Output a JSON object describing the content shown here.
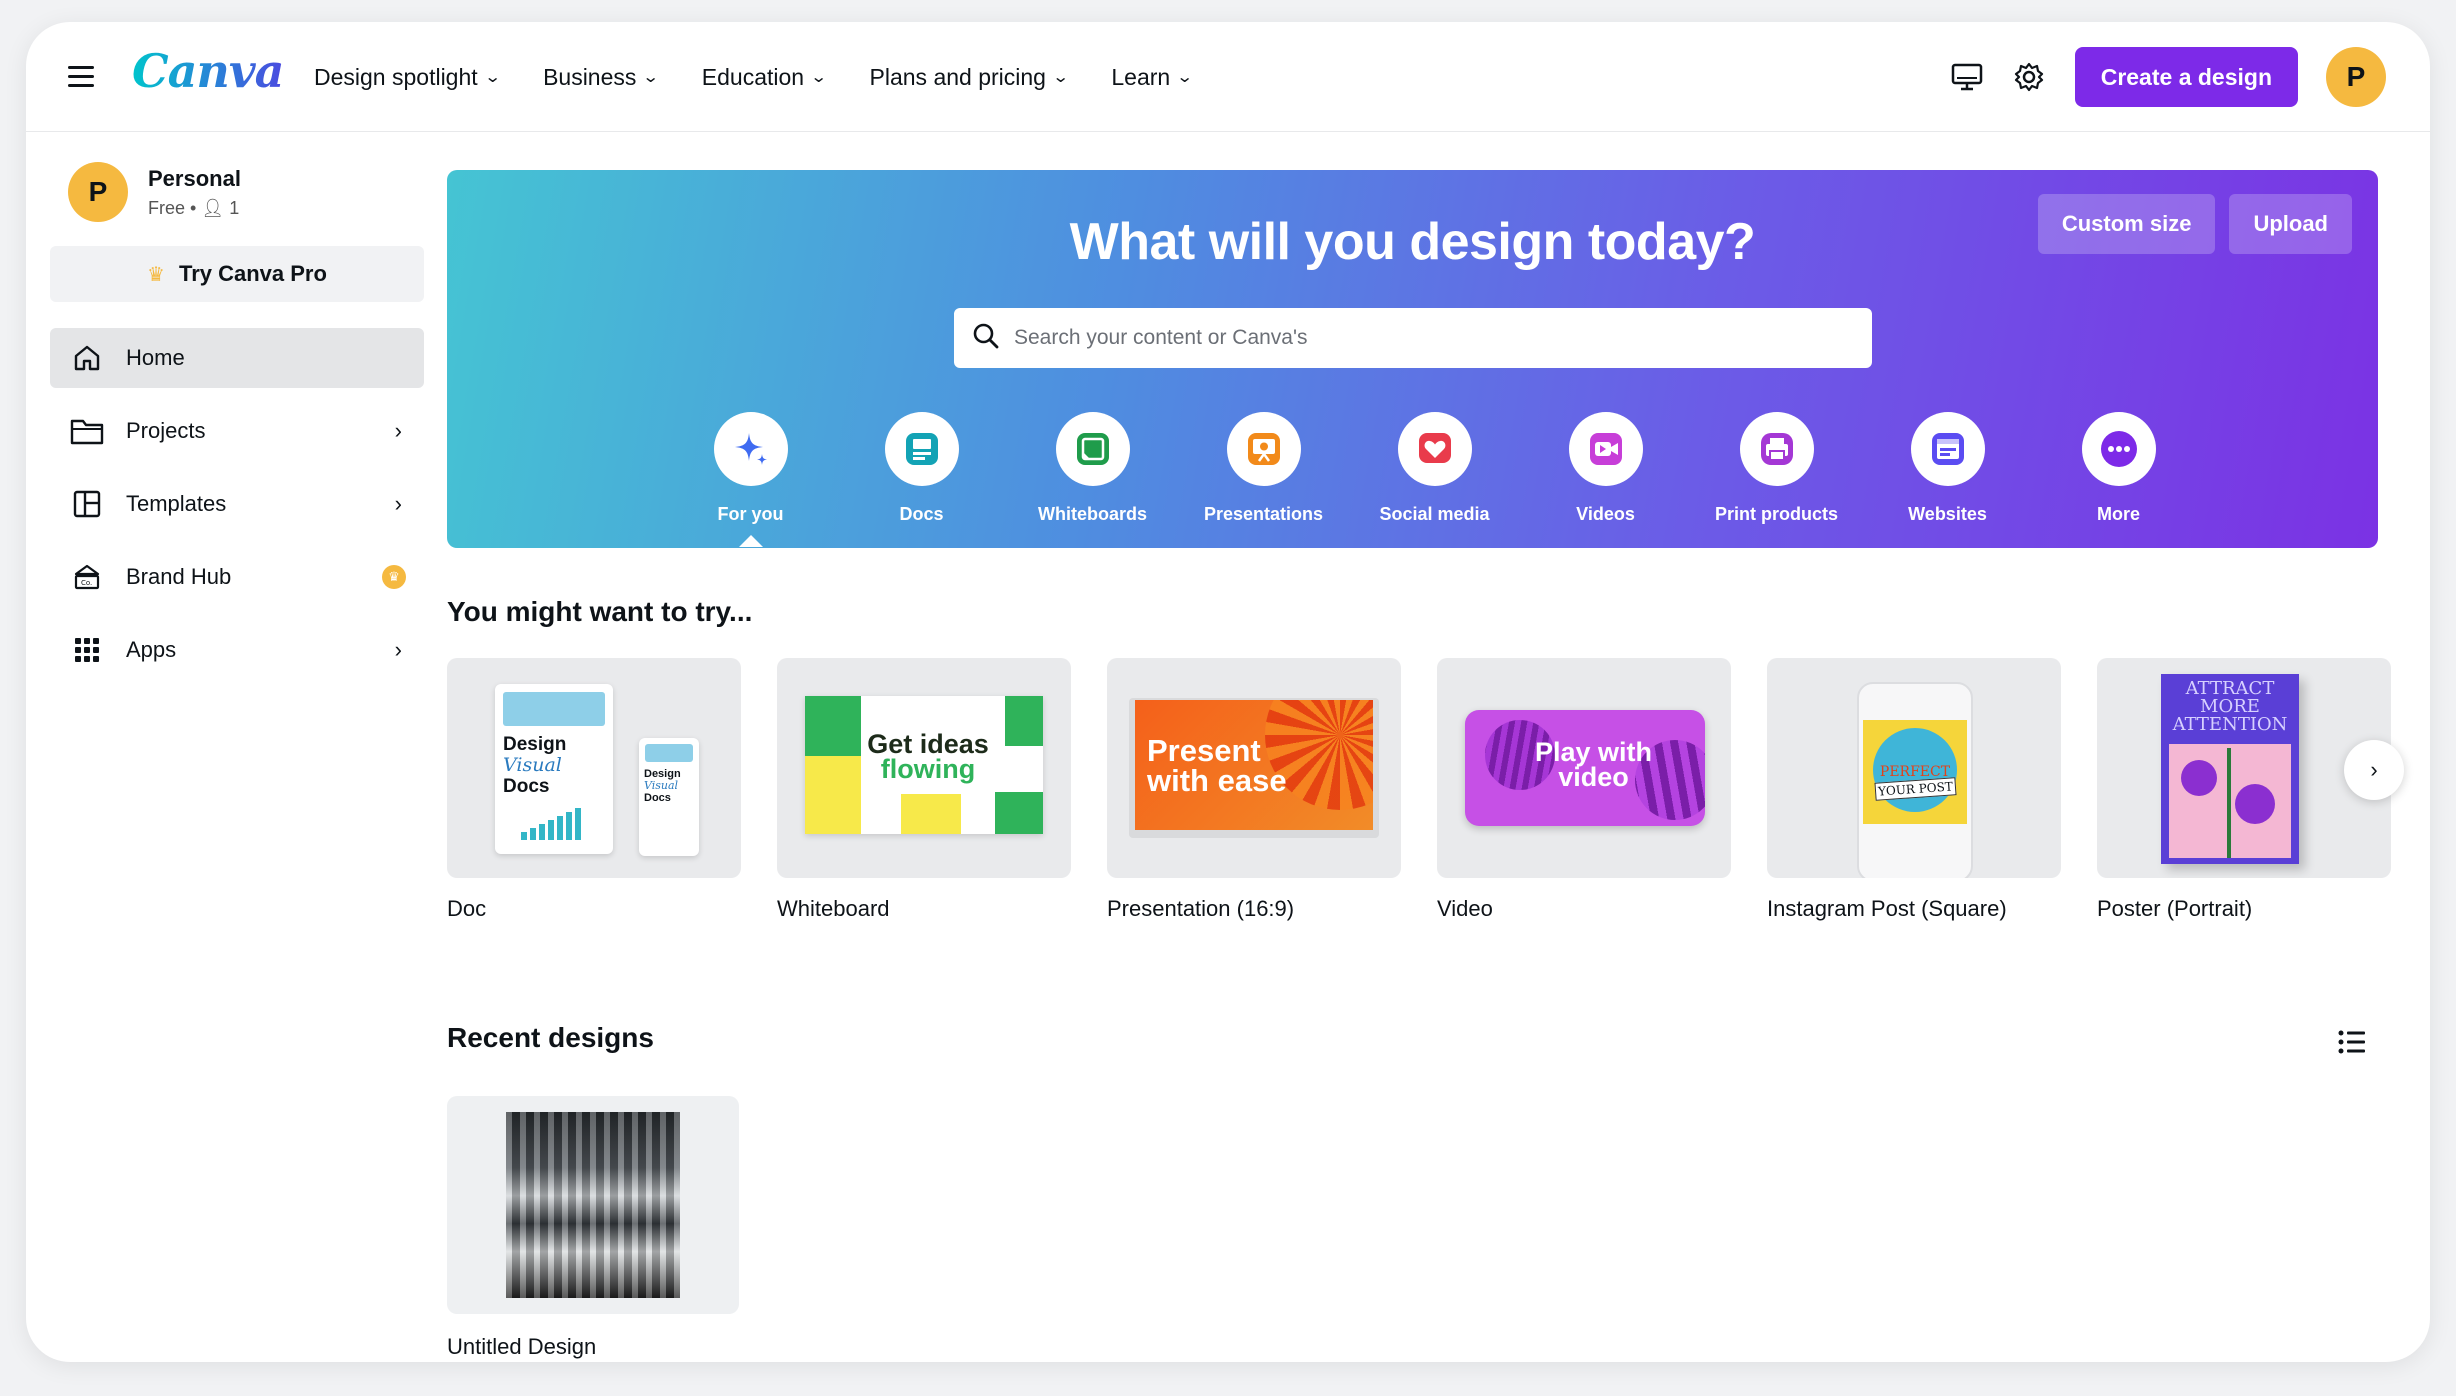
{
  "header": {
    "logo": "Canva",
    "nav": [
      {
        "label": "Design spotlight"
      },
      {
        "label": "Business"
      },
      {
        "label": "Education"
      },
      {
        "label": "Plans and pricing"
      },
      {
        "label": "Learn"
      }
    ],
    "create_label": "Create a design",
    "avatar_initial": "P"
  },
  "sidebar": {
    "account_name": "Personal",
    "account_plan": "Free",
    "member_count": "1",
    "avatar_initial": "P",
    "try_pro": "Try Canva Pro",
    "items": [
      {
        "label": "Home",
        "icon": "home-icon"
      },
      {
        "label": "Projects",
        "icon": "folder-icon"
      },
      {
        "label": "Templates",
        "icon": "templates-icon"
      },
      {
        "label": "Brand Hub",
        "icon": "brand-icon"
      },
      {
        "label": "Apps",
        "icon": "apps-grid-icon"
      }
    ]
  },
  "hero": {
    "title": "What will you design today?",
    "custom_size": "Custom size",
    "upload": "Upload",
    "search_placeholder": "Search your content or Canva's",
    "categories": [
      {
        "label": "For you",
        "color": "#3f6bf1"
      },
      {
        "label": "Docs",
        "color": "#13a3b5"
      },
      {
        "label": "Whiteboards",
        "color": "#1f9c4b"
      },
      {
        "label": "Presentations",
        "color": "#f28a1a"
      },
      {
        "label": "Social media",
        "color": "#e93b4b"
      },
      {
        "label": "Videos",
        "color": "#c73ed8"
      },
      {
        "label": "Print products",
        "color": "#a437d5"
      },
      {
        "label": "Websites",
        "color": "#5b4cf2"
      },
      {
        "label": "More",
        "color": "#7d2ae8"
      }
    ]
  },
  "try_section": {
    "title": "You might want to try...",
    "cards": [
      {
        "label": "Doc",
        "art": [
          "Design",
          "Visual",
          "Docs"
        ]
      },
      {
        "label": "Whiteboard",
        "art": [
          "Get ideas",
          "flowing"
        ]
      },
      {
        "label": "Presentation (16:9)",
        "art": [
          "Present",
          "with ease"
        ]
      },
      {
        "label": "Video",
        "art": [
          "Play with",
          "video"
        ]
      },
      {
        "label": "Instagram Post (Square)",
        "art": [
          "PERFECT",
          "YOUR POST"
        ]
      },
      {
        "label": "Poster (Portrait)",
        "art": [
          "ATTRACT",
          "MORE",
          "ATTENTION"
        ]
      }
    ]
  },
  "recent_section": {
    "title": "Recent designs",
    "items": [
      {
        "label": "Untitled Design"
      }
    ]
  }
}
